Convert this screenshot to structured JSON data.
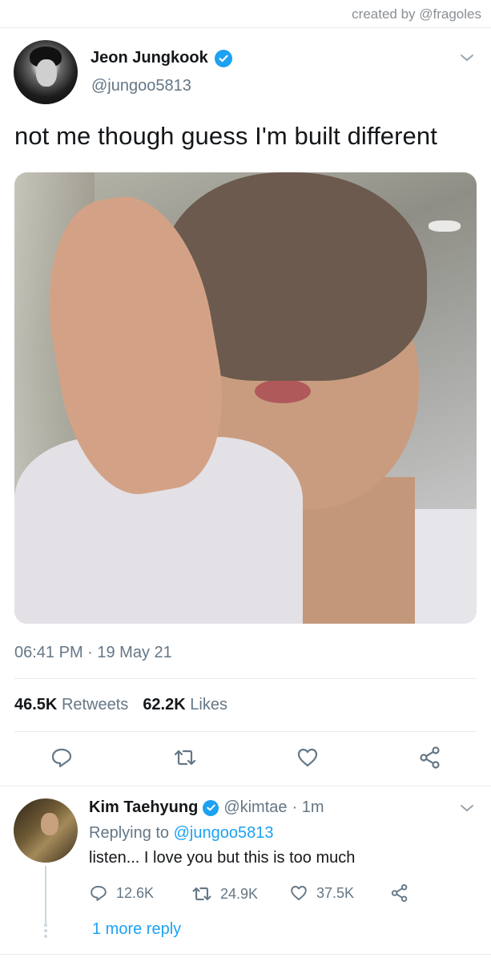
{
  "credit": "created by @fragoles",
  "tweet": {
    "author_name": "Jeon Jungkook",
    "author_handle": "@jungoo5813",
    "text": "not me though guess I'm built different",
    "timestamp": "06:41 PM · 19 May 21",
    "retweets_count": "46.5K",
    "retweets_label": "Retweets",
    "likes_count": "62.2K",
    "likes_label": "Likes",
    "icons": [
      "reply-icon",
      "retweet-icon",
      "like-icon",
      "share-icon"
    ]
  },
  "reply": {
    "author_name": "Kim Taehyung",
    "author_handle": "@kimtae",
    "time": "· 1m",
    "replying_prefix": "Replying to",
    "replying_to": "@jungoo5813",
    "text": "listen... I love you but this is too much",
    "reply_count": "12.6K",
    "retweet_count": "24.9K",
    "like_count": "37.5K",
    "more_replies": "1 more reply"
  },
  "colors": {
    "accent": "#1da1f2",
    "text_primary": "#14171a",
    "text_secondary": "#657786",
    "divider": "#e6ecf0"
  }
}
